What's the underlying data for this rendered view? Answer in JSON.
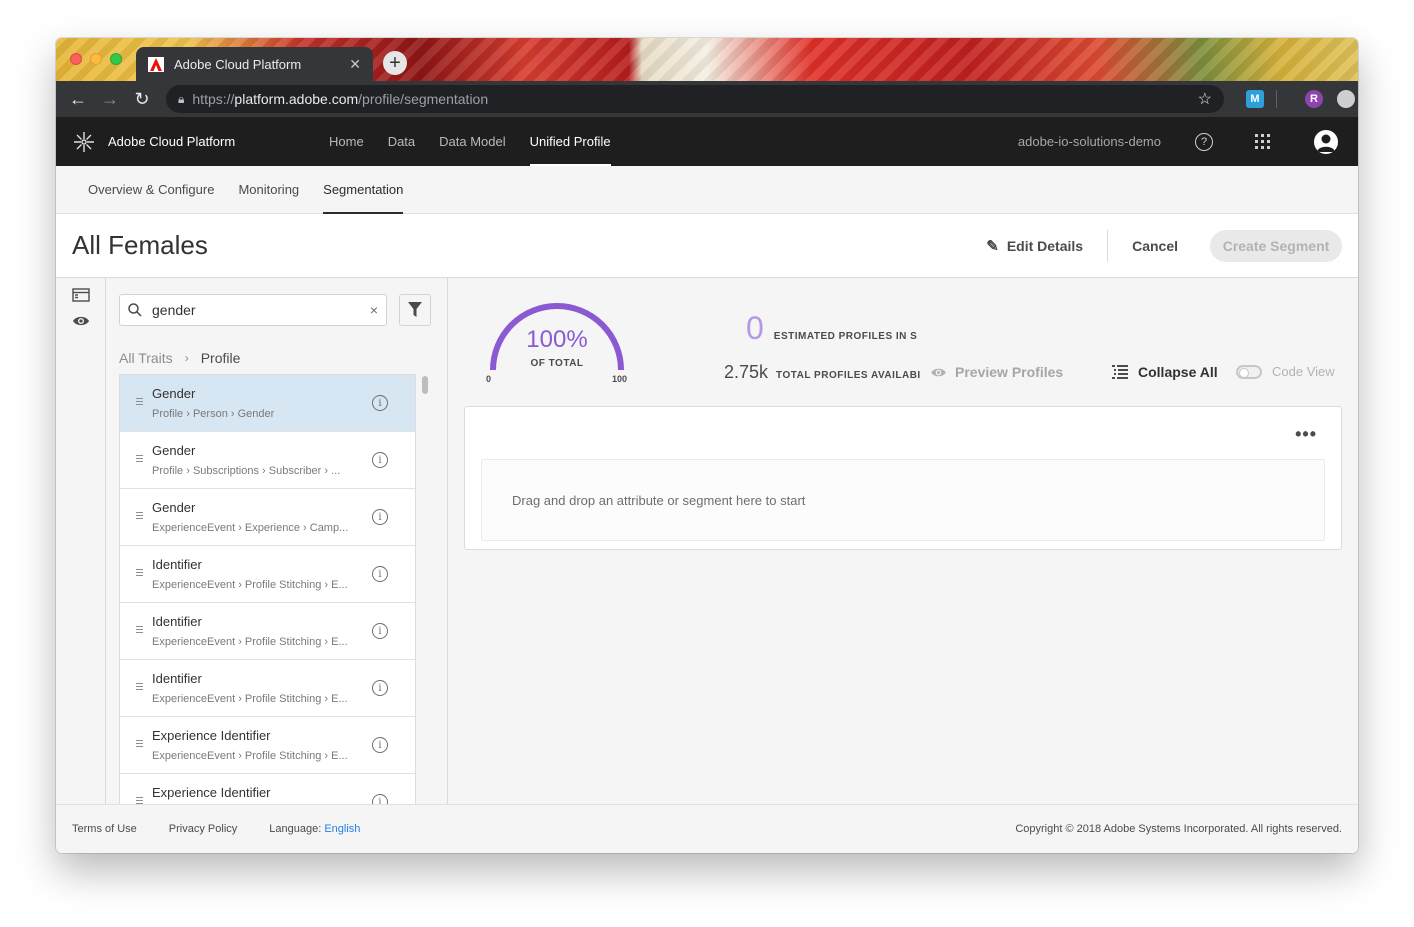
{
  "browser": {
    "tab_title": "Adobe Cloud Platform",
    "url_scheme": "https://",
    "url_host": "platform.adobe.com",
    "url_path": "/profile/segmentation",
    "extensions": [
      "M",
      "R"
    ]
  },
  "appbar": {
    "brand": "Adobe Cloud Platform",
    "nav": [
      {
        "label": "Home"
      },
      {
        "label": "Data"
      },
      {
        "label": "Data Model"
      },
      {
        "label": "Unified Profile"
      }
    ],
    "org": "adobe-io-solutions-demo",
    "help_glyph": "?"
  },
  "subnav": [
    {
      "label": "Overview & Configure"
    },
    {
      "label": "Monitoring"
    },
    {
      "label": "Segmentation"
    }
  ],
  "title": {
    "segment_name": "All Females",
    "edit_label": "Edit Details",
    "cancel_label": "Cancel",
    "create_label": "Create Segment"
  },
  "search": {
    "value": "gender",
    "clear_glyph": "×"
  },
  "breadcrumb": {
    "root": "All Traits",
    "separator": "›",
    "current": "Profile"
  },
  "traits": [
    {
      "name": "Gender",
      "path": "Profile › Person › Gender"
    },
    {
      "name": "Gender",
      "path": "Profile › Subscriptions › Subscriber › ..."
    },
    {
      "name": "Gender",
      "path": "ExperienceEvent › Experience › Camp..."
    },
    {
      "name": "Identifier",
      "path": "ExperienceEvent › Profile Stitching › E..."
    },
    {
      "name": "Identifier",
      "path": "ExperienceEvent › Profile Stitching › E..."
    },
    {
      "name": "Identifier",
      "path": "ExperienceEvent › Profile Stitching › E..."
    },
    {
      "name": "Experience Identifier",
      "path": "ExperienceEvent › Profile Stitching › E..."
    },
    {
      "name": "Experience Identifier",
      "path": ""
    }
  ],
  "estimate": {
    "percent": "100%",
    "percent_label": "OF TOTAL",
    "percent_value": 1.0,
    "min": "0",
    "max": "100",
    "estimated_count": "0",
    "estimated_label": "ESTIMATED PROFILES IN S",
    "total_count": "2.75k",
    "total_label": "TOTAL PROFILES AVAILABI",
    "gauge_color": "#8b5ad3"
  },
  "actions": {
    "preview_label": "Preview Profiles",
    "collapse_label": "Collapse All",
    "code_view_label": "Code View",
    "more_glyph": "•••"
  },
  "canvas": {
    "dropzone_text": "Drag and drop an attribute or segment here to start"
  },
  "footer": {
    "terms": "Terms of Use",
    "privacy": "Privacy Policy",
    "language_label": "Language:",
    "language_value": "English",
    "copyright": "Copyright ©  2018 Adobe Systems Incorporated.  All rights reserved."
  }
}
